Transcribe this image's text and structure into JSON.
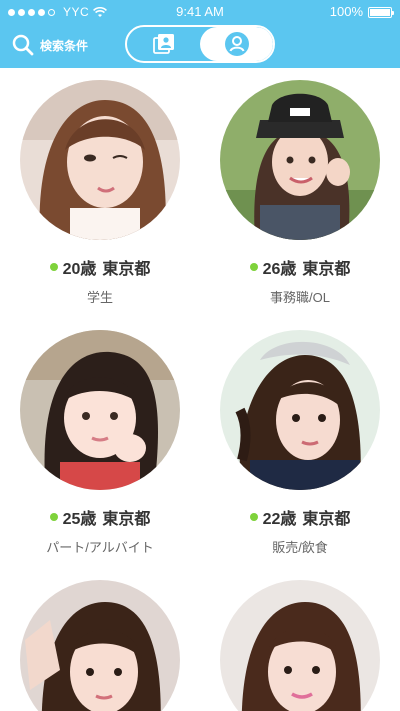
{
  "status": {
    "carrier": "YYC",
    "time": "9:41 AM",
    "battery": "100%"
  },
  "header": {
    "search_label": "検索条件",
    "segments": [
      {
        "icon": "card-list-icon",
        "active": false
      },
      {
        "icon": "person-icon",
        "active": true
      }
    ]
  },
  "colors": {
    "header": "#5bc6f0",
    "online": "#7ed23b",
    "text": "#333333",
    "subtext": "#666666"
  },
  "users": [
    {
      "age": "20歳",
      "location": "東京都",
      "occupation": "学生",
      "online": true
    },
    {
      "age": "26歳",
      "location": "東京都",
      "occupation": "事務職/OL",
      "online": true
    },
    {
      "age": "25歳",
      "location": "東京都",
      "occupation": "パート/アルバイト",
      "online": true
    },
    {
      "age": "22歳",
      "location": "東京都",
      "occupation": "販売/飲食",
      "online": true
    },
    {
      "age": "",
      "location": "",
      "occupation": "",
      "online": false
    },
    {
      "age": "",
      "location": "",
      "occupation": "",
      "online": false
    }
  ]
}
